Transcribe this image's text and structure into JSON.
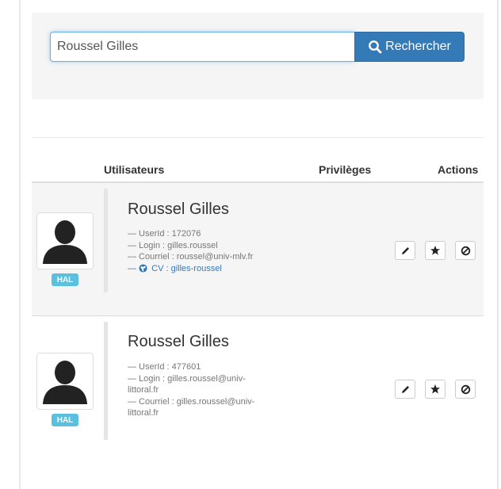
{
  "search": {
    "value": "Roussel Gilles",
    "button_label": "Rechercher"
  },
  "table": {
    "headers": {
      "users": "Utilisateurs",
      "privileges": "Privilèges",
      "actions": "Actions"
    }
  },
  "users": [
    {
      "name": "Roussel Gilles",
      "badge": "HAL",
      "userid": "— UserId : 172076",
      "login": "— Login : gilles.roussel",
      "email": "— Courriel : roussel@univ-mlv.fr",
      "cv": "CV : gilles-roussel",
      "cv_prefix": "— "
    },
    {
      "name": "Roussel Gilles",
      "badge": "HAL",
      "userid": "— UserId : 477601",
      "login": "— Login : gilles.roussel@univ-littoral.fr",
      "email": "— Courriel : gilles.roussel@univ-littoral.fr"
    }
  ],
  "icons": {
    "search": "search-icon",
    "edit": "pencil-icon",
    "favorite": "star-icon",
    "disable": "ban-icon",
    "cv": "globe-icon",
    "avatar": "user-silhouette-icon"
  },
  "colors": {
    "primary": "#337ab7",
    "badge": "#5bc0de",
    "panel": "#f5f5f5"
  }
}
